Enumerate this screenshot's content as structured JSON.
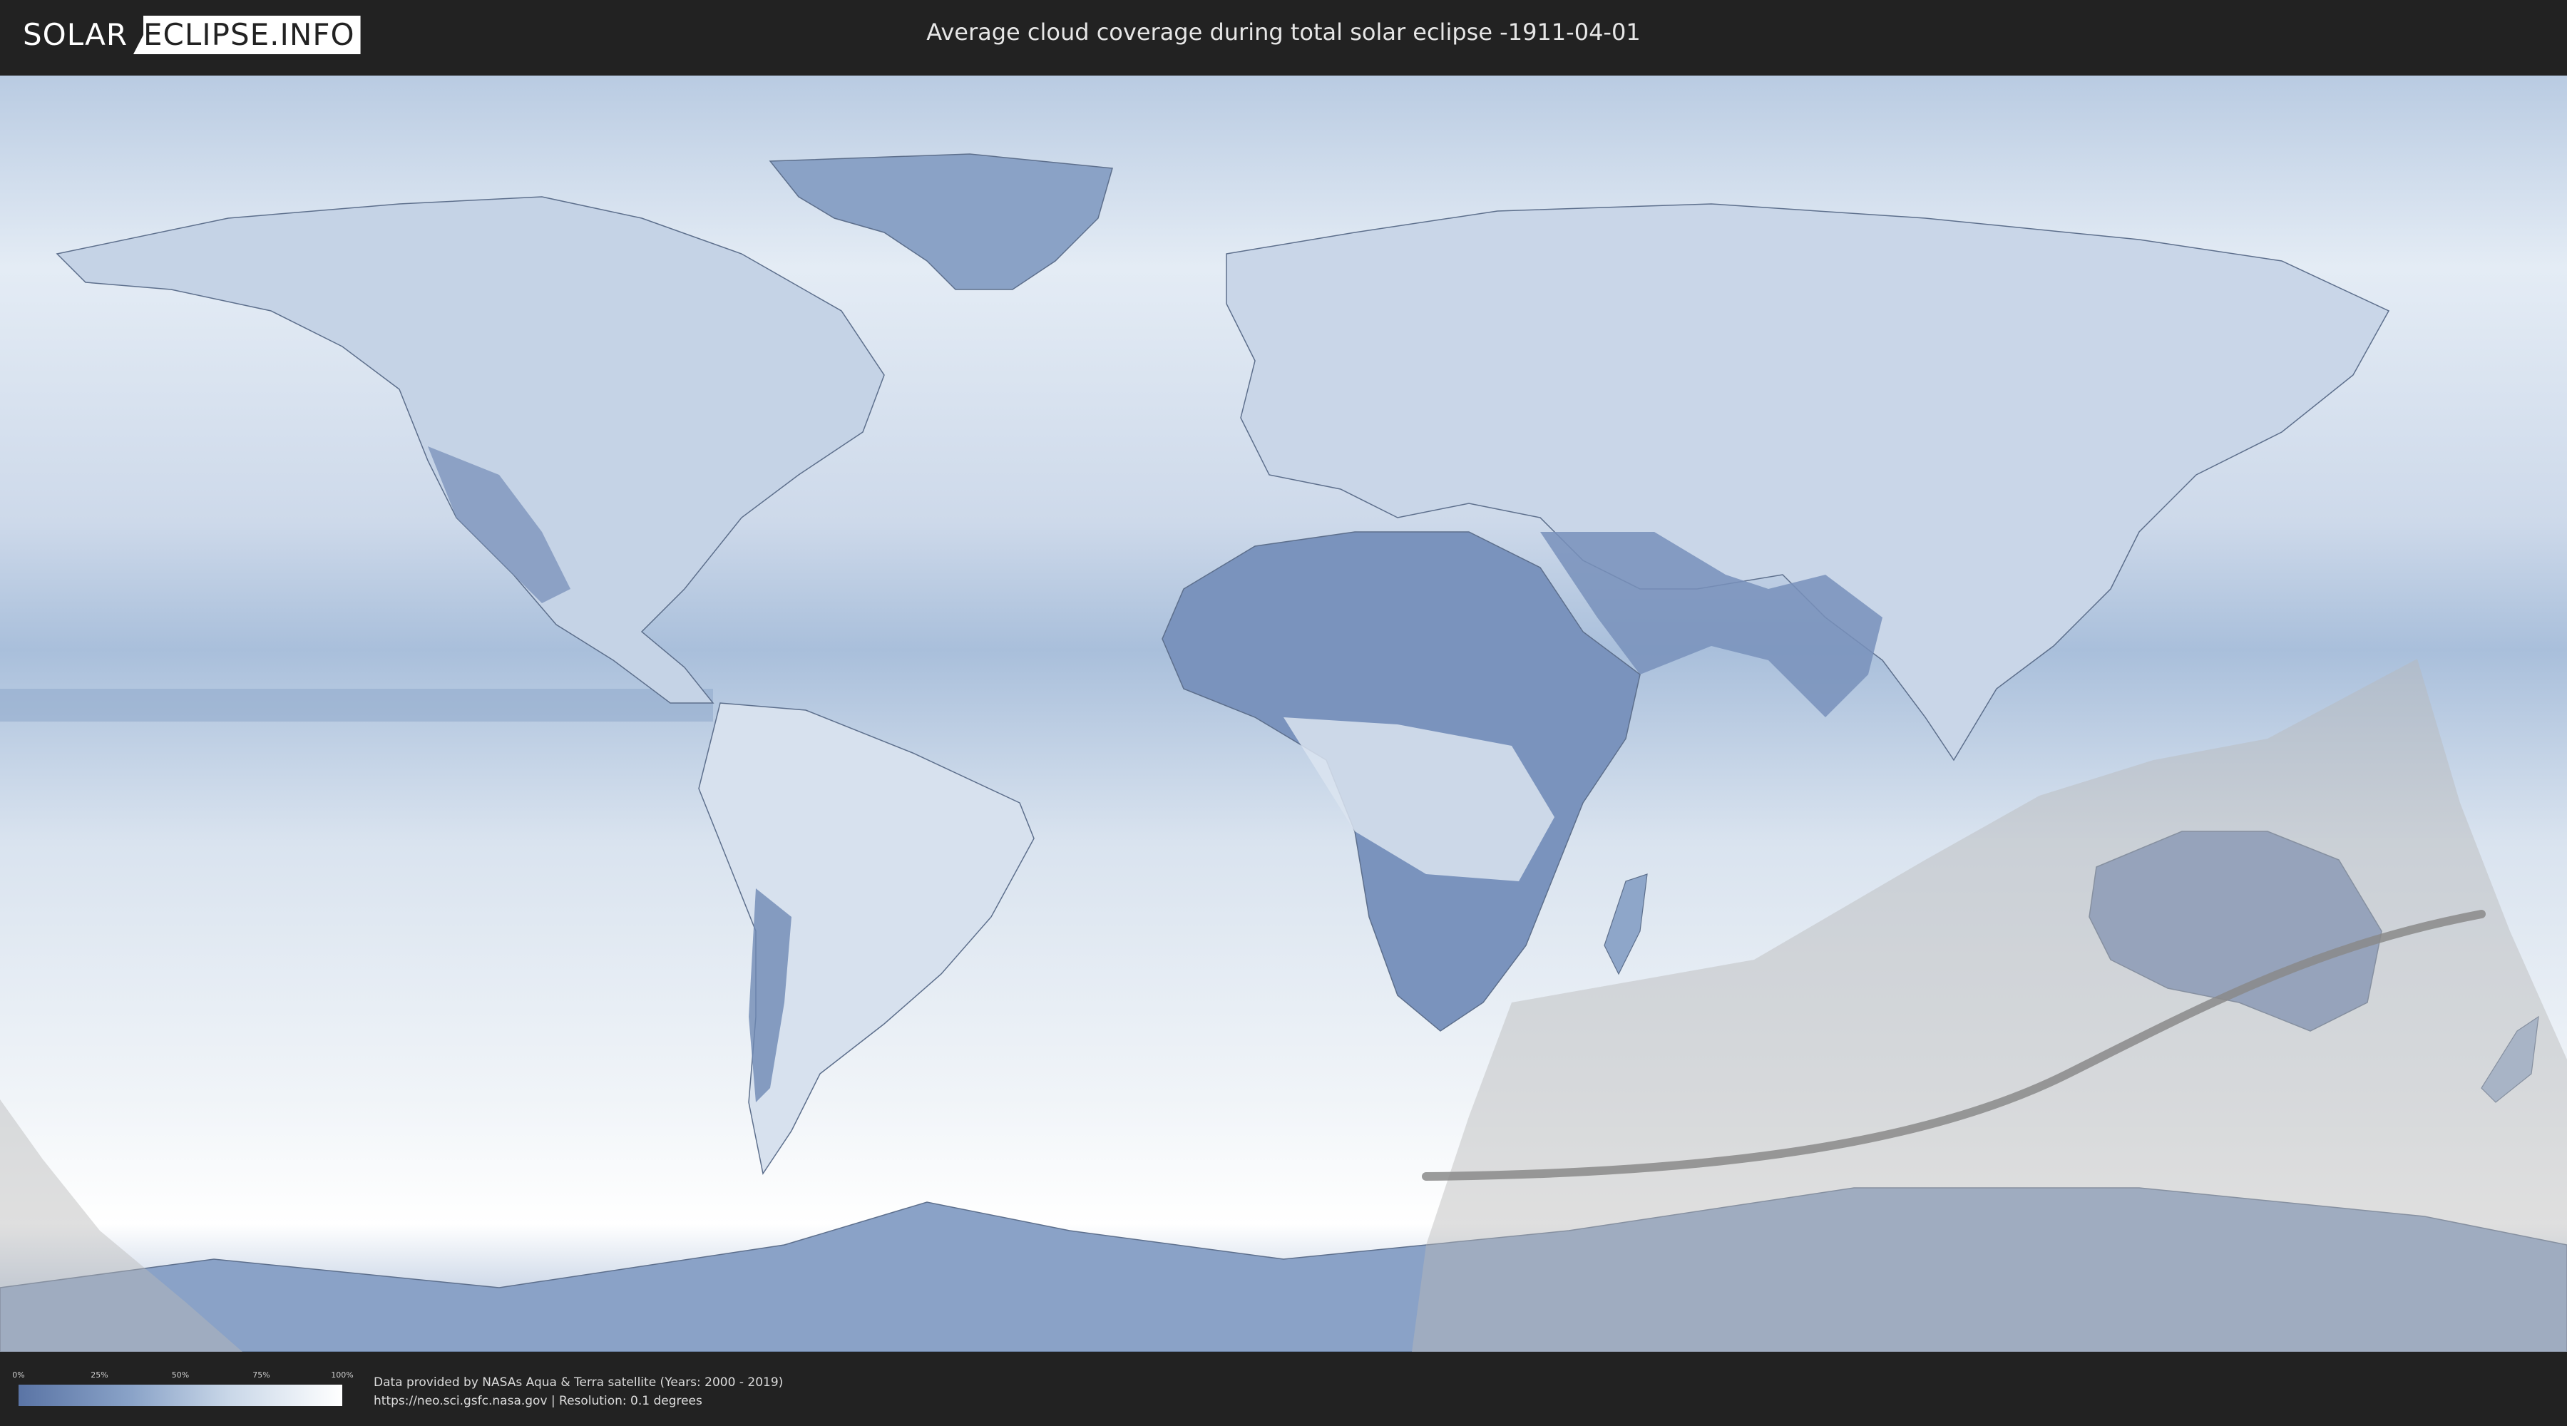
{
  "header": {
    "logo_left": "SOLAR",
    "logo_right": "ECLIPSE.INFO",
    "title": "Average cloud coverage during total solar eclipse -1911-04-01"
  },
  "legend": {
    "ticks": [
      "0%",
      "25%",
      "50%",
      "75%",
      "100%"
    ],
    "gradient_colors": [
      "#5a74a5",
      "#8aa3c8",
      "#c9d7e8",
      "#ffffff"
    ]
  },
  "footer": {
    "credit_line_1": "Data provided by NASAs Aqua & Terra satellite (Years: 2000 - 2019)",
    "credit_line_2": "https://neo.sci.gsfc.nasa.gov | Resolution: 0.1 degrees"
  },
  "colors": {
    "background": "#222222",
    "ocean_clear": "#dbe6f1",
    "land_clear": "#7f97bf",
    "eclipse_overlay": "#bdbdbd",
    "eclipse_path": "#8a8a8a"
  }
}
